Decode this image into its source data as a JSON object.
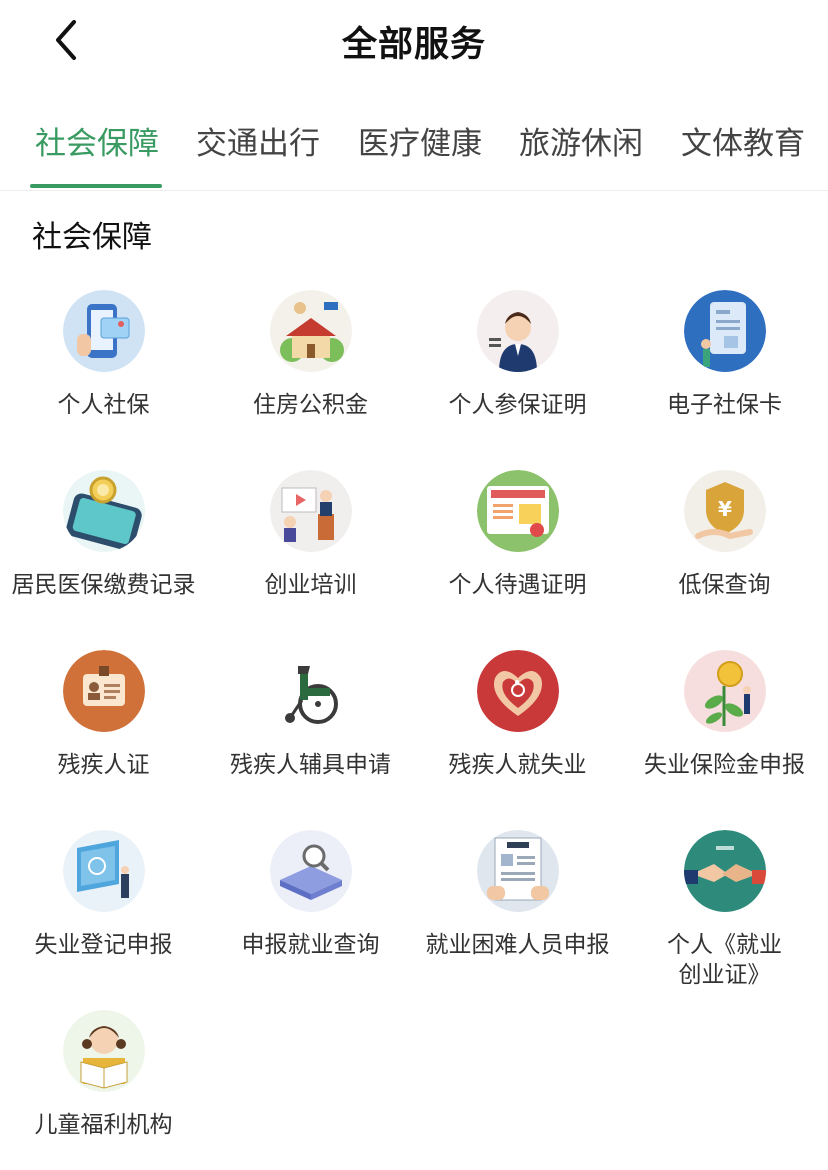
{
  "header": {
    "title": "全部服务",
    "back_icon": "chevron-left-icon"
  },
  "tabs": [
    {
      "label": "社会保障",
      "active": true
    },
    {
      "label": "交通出行",
      "active": false
    },
    {
      "label": "医疗健康",
      "active": false
    },
    {
      "label": "旅游休闲",
      "active": false
    },
    {
      "label": "文体教育",
      "active": false
    }
  ],
  "accent_color": "#3a9b62",
  "section": {
    "title": "社会保障",
    "items": [
      {
        "label": "个人社保",
        "icon": "phone-card-icon"
      },
      {
        "label": "住房公积金",
        "icon": "house-icon"
      },
      {
        "label": "个人参保证明",
        "icon": "officer-icon"
      },
      {
        "label": "电子社保卡",
        "icon": "id-card-icon"
      },
      {
        "label": "居民医保缴费记录",
        "icon": "magnifier-phone-icon"
      },
      {
        "label": "创业培训",
        "icon": "presentation-icon"
      },
      {
        "label": "个人待遇证明",
        "icon": "certificate-icon"
      },
      {
        "label": "低保查询",
        "icon": "yuan-shield-icon"
      },
      {
        "label": "残疾人证",
        "icon": "badge-card-icon"
      },
      {
        "label": "残疾人辅具申请",
        "icon": "wheelchair-icon"
      },
      {
        "label": "残疾人就失业",
        "icon": "heart-hands-icon"
      },
      {
        "label": "失业保险金申报",
        "icon": "coin-plant-icon"
      },
      {
        "label": "失业登记申报",
        "icon": "register-screen-icon"
      },
      {
        "label": "申报就业查询",
        "icon": "search-platform-icon"
      },
      {
        "label": "就业困难人员申报",
        "icon": "resume-icon"
      },
      {
        "label": "个人《就业\n创业证》",
        "icon": "handshake-icon"
      },
      {
        "label": "儿童福利机构",
        "icon": "child-reading-icon"
      }
    ]
  }
}
